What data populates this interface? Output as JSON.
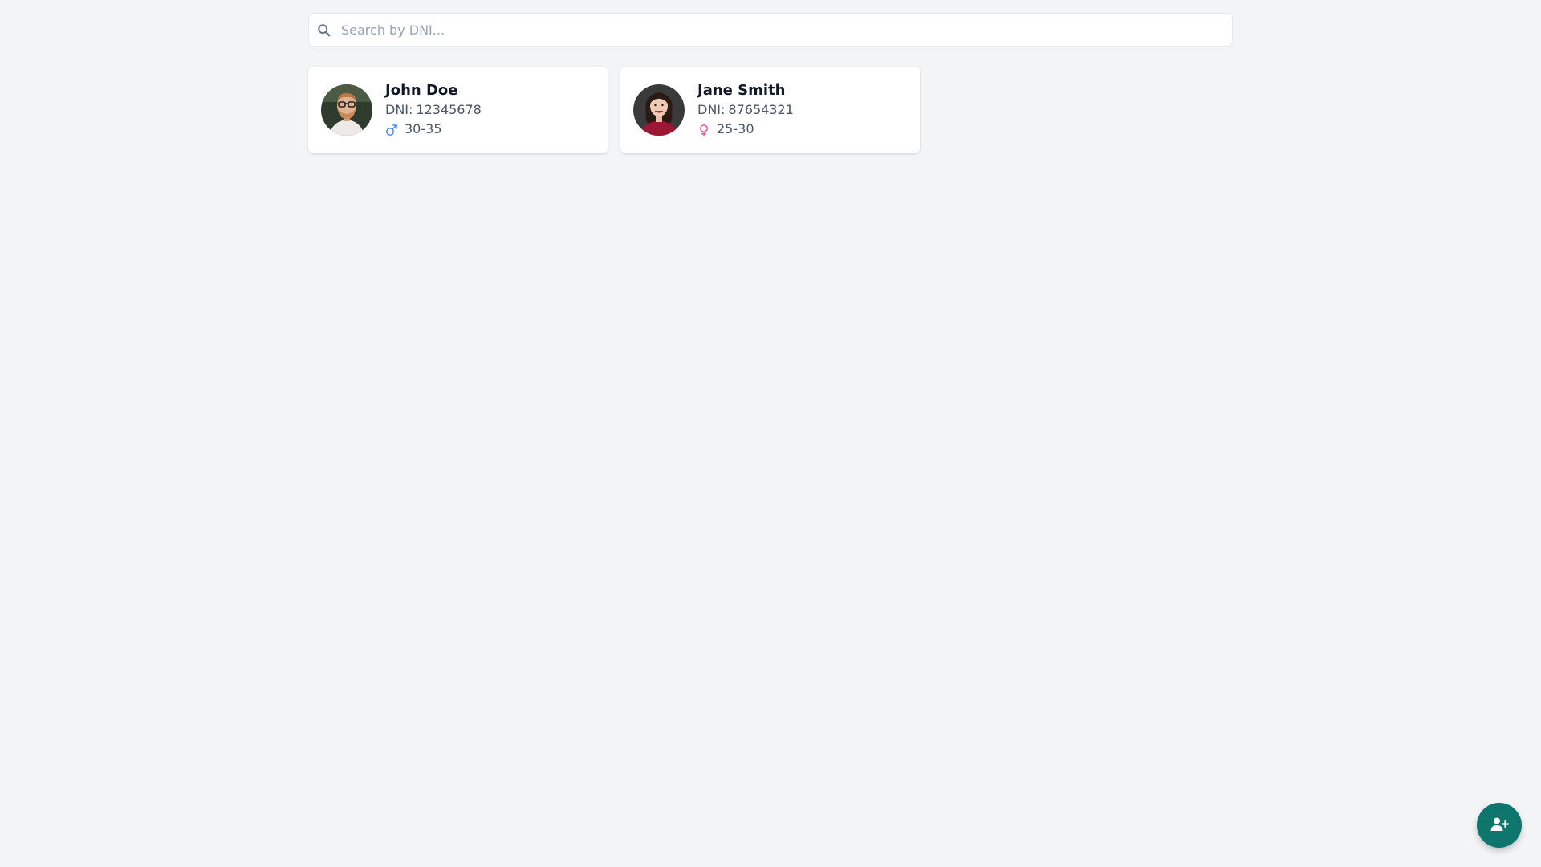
{
  "search": {
    "placeholder": "Search by DNI...",
    "value": "",
    "icon": "search-icon"
  },
  "people": [
    {
      "name": "John Doe",
      "dni_label": "DNI:",
      "dni": "12345678",
      "gender": "male",
      "gender_icon": "male-icon",
      "gender_color": "#3b82f6",
      "age_range": "30-35"
    },
    {
      "name": "Jane Smith",
      "dni_label": "DNI:",
      "dni": "87654321",
      "gender": "female",
      "gender_icon": "female-icon",
      "gender_color": "#ec4899",
      "age_range": "25-30"
    }
  ],
  "fab": {
    "icon": "add-user-icon",
    "color": "#0f766e"
  }
}
